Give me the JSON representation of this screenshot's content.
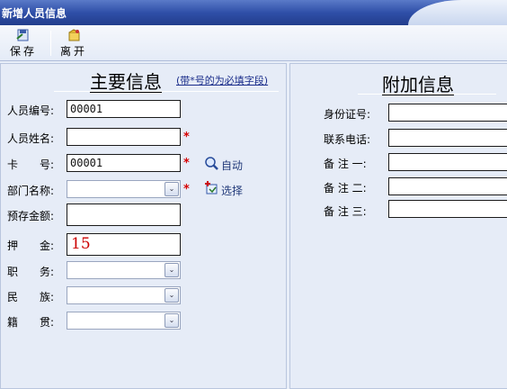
{
  "window": {
    "title": "新增人员信息"
  },
  "toolbar": {
    "save_label": "保存",
    "leave_label": "离开"
  },
  "main": {
    "heading": "主要信息",
    "hint": "(带*号的为必填字段)",
    "fields": {
      "emp_no": {
        "label": "人员编号:",
        "value": "00001"
      },
      "name": {
        "label": "人员姓名:",
        "value": ""
      },
      "card_no": {
        "label": "卡　　号:",
        "value": "00001",
        "action": "自动"
      },
      "dept": {
        "label": "部门名称:",
        "value": "",
        "action": "选择"
      },
      "prepaid": {
        "label": "预存金额:",
        "value": ""
      },
      "deposit": {
        "label": "押　　金:",
        "value": "15"
      },
      "position": {
        "label": "职　　务:",
        "value": ""
      },
      "ethnicity": {
        "label": "民　　族:",
        "value": ""
      },
      "native_place": {
        "label": "籍　　贯:",
        "value": ""
      }
    },
    "required_mark": "*"
  },
  "extra": {
    "heading": "附加信息",
    "fields": {
      "id_no": {
        "label": "身份证号:",
        "value": ""
      },
      "phone": {
        "label": "联系电话:",
        "value": ""
      },
      "note1": {
        "label": "备 注 一:",
        "value": ""
      },
      "note2": {
        "label": "备 注 二:",
        "value": ""
      },
      "note3": {
        "label": "备 注 三:",
        "value": ""
      }
    }
  },
  "colors": {
    "title_bar": "#2f4fa8",
    "required": "#d60000",
    "deposit_text": "#cc0000",
    "panel_bg": "#e6ecf7"
  }
}
